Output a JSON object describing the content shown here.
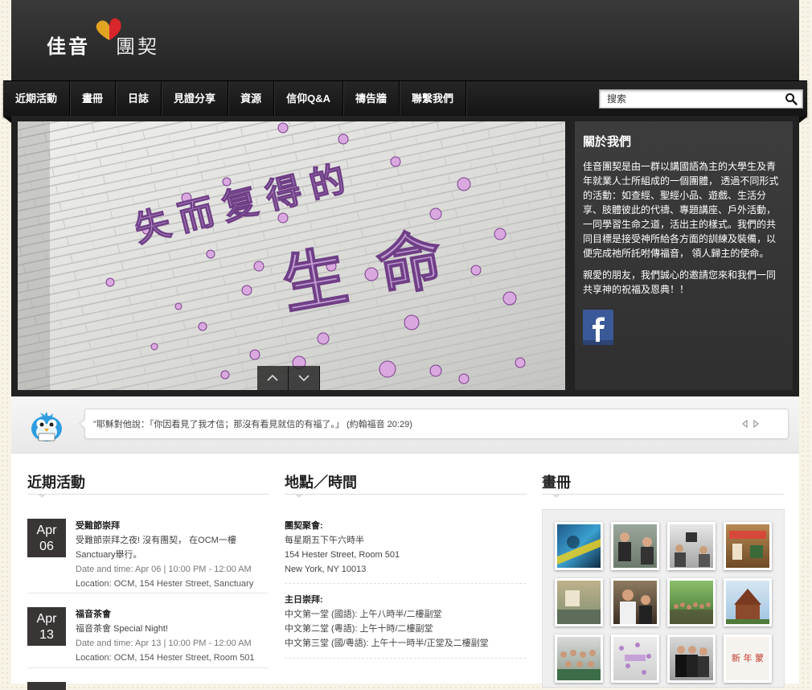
{
  "logo": {
    "left": "佳音",
    "right": "團契"
  },
  "nav": {
    "items": [
      "近期活動",
      "畫冊",
      "日誌",
      "見證分享",
      "資源",
      "信仰Q&A",
      "禱告牆",
      "聯繫我們"
    ],
    "search_placeholder": "搜索"
  },
  "hero": {
    "slide_text_small": "失而复得的",
    "slide_text_big": "生命"
  },
  "about": {
    "title": "關於我們",
    "paragraph1": "佳音團契是由一群以講國語為主的大學生及青年就業人士所組成的一個團體， 透過不同形式的活動：如查經、聖經小品、遊戲、生活分享、肢體彼此的代禱、專題講座、戶外活動， 一同學習生命之道，活出主的樣式。我們的共同目標是接受神所給各方面的訓練及裝備，以便完成祂所託咐傳福音， 領人歸主的使命。",
    "paragraph2": "親愛的朋友，我們誠心的邀請您來和我們一同共享神的祝福及恩典！！"
  },
  "quote": {
    "text": "\"耶穌對他說：「你因看見了我才信；那沒有看見就信的有福了。」 (約翰福音 20:29)"
  },
  "events": {
    "title": "近期活動",
    "items": [
      {
        "month": "Apr",
        "day": "06",
        "title": "受難節崇拜",
        "desc": "受難節崇拜之夜! 沒有團契， 在OCM一樓Sanctuary舉行。",
        "time": "Date and time: Apr 06 | 10:00 PM - 12:00 AM",
        "location": "Location: OCM, 154 Hester Street, Sanctuary"
      },
      {
        "month": "Apr",
        "day": "13",
        "title": "福音茶會",
        "desc": "福音茶會 Special Night!",
        "time": "Date and time: Apr 13 | 10:00 PM - 12:00 AM",
        "location": "Location: OCM, 154 Hester Street, Room 501"
      }
    ]
  },
  "location": {
    "title": "地點／時間",
    "fellowship": {
      "heading": "團契聚會:",
      "lines": [
        "每星期五下午六時半",
        "154 Hester Street, Room 501",
        "New York, NY 10013"
      ]
    },
    "worship": {
      "heading": "主日崇拜:",
      "lines": [
        "中文第一堂 (國語): 上午八時半/二樓副堂",
        "中文第二堂 (粵語): 上午十時/二樓副堂",
        "中文第三堂 (國/粵語): 上午十一時半/正堂及二樓副堂"
      ]
    }
  },
  "gallery": {
    "title": "畫冊",
    "thumb_text": "新 年 蒙"
  },
  "colors": {
    "accent_purple": "#9b63b8",
    "header_dark": "#2a2a2a",
    "facebook_blue": "#3b5998"
  }
}
